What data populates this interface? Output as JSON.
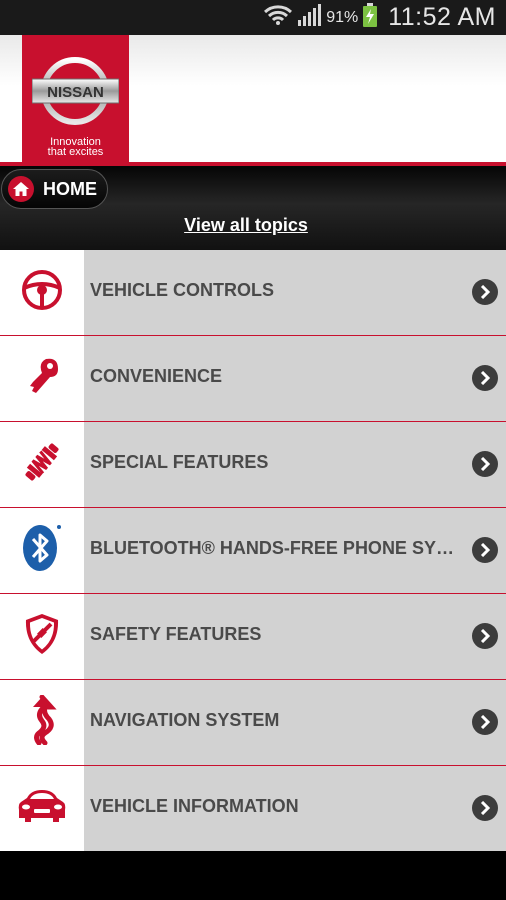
{
  "status_bar": {
    "battery_percent": "91%",
    "time": "11:52 AM",
    "icons": [
      "wifi-icon",
      "signal-icon",
      "battery-charging-icon"
    ]
  },
  "header": {
    "logo_text": "NISSAN",
    "tagline_line1": "Innovation",
    "tagline_line2": "that excites",
    "accent_color": "#c8102e"
  },
  "nav": {
    "home_label": "HOME",
    "view_all_label": "View all topics"
  },
  "menu": {
    "items": [
      {
        "label": "VEHICLE CONTROLS",
        "icon": "steering-wheel-icon"
      },
      {
        "label": "CONVENIENCE",
        "icon": "key-icon"
      },
      {
        "label": "SPECIAL FEATURES",
        "icon": "shock-absorber-icon"
      },
      {
        "label": "BLUETOOTH® HANDS-FREE PHONE SYSTEM",
        "icon": "bluetooth-icon"
      },
      {
        "label": "SAFETY FEATURES",
        "icon": "safety-shield-icon"
      },
      {
        "label": "NAVIGATION SYSTEM",
        "icon": "navigation-road-icon"
      },
      {
        "label": "VEHICLE INFORMATION",
        "icon": "car-front-icon"
      }
    ]
  }
}
